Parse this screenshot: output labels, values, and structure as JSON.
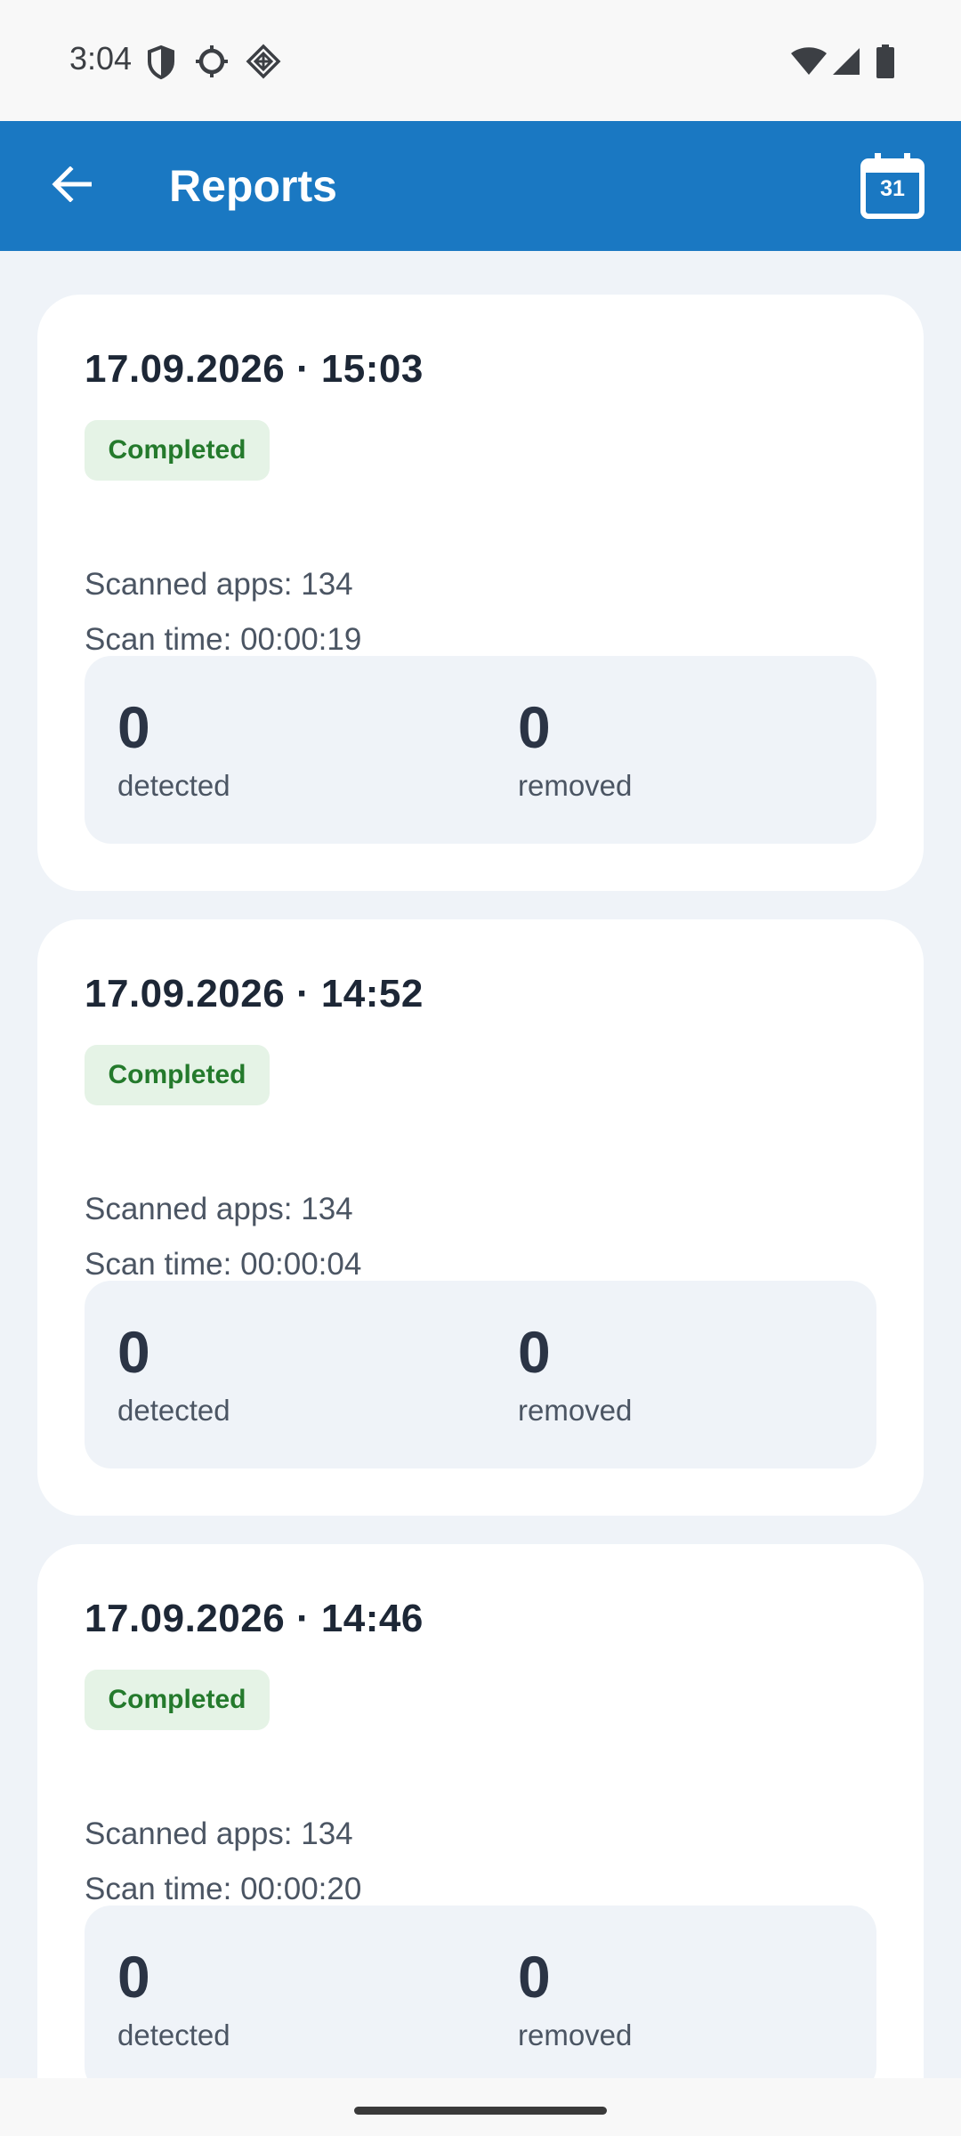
{
  "status_bar": {
    "time": "3:04",
    "icons": [
      "shield-icon",
      "circle-sync-icon",
      "diamond-grid-icon",
      "wifi-icon",
      "cell-signal-icon",
      "battery-icon"
    ]
  },
  "app_bar": {
    "title": "Reports",
    "back_icon": "arrow-back-icon",
    "calendar_icon": "calendar-icon",
    "calendar_day": "31",
    "color": "#1a78c2"
  },
  "reports": [
    {
      "date": "17.09.2026 · 15:03",
      "status": "Completed",
      "scanned_apps": "Scanned apps: 134",
      "scan_time": "Scan time: 00:00:19",
      "detected_value": "0",
      "detected_label": "detected",
      "removed_value": "0",
      "removed_label": "removed"
    },
    {
      "date": "17.09.2026 · 14:52",
      "status": "Completed",
      "scanned_apps": "Scanned apps: 134",
      "scan_time": "Scan time: 00:00:04",
      "detected_value": "0",
      "detected_label": "detected",
      "removed_value": "0",
      "removed_label": "removed"
    },
    {
      "date": "17.09.2026 · 14:46",
      "status": "Completed",
      "scanned_apps": "Scanned apps: 134",
      "scan_time": "Scan time: 00:00:20",
      "detected_value": "0",
      "detected_label": "detected",
      "removed_value": "0",
      "removed_label": "removed"
    }
  ],
  "colors": {
    "accent": "#1a78c2",
    "background": "#eff3f8",
    "badge_bg": "#e5f3e6",
    "badge_text": "#247a2c"
  }
}
